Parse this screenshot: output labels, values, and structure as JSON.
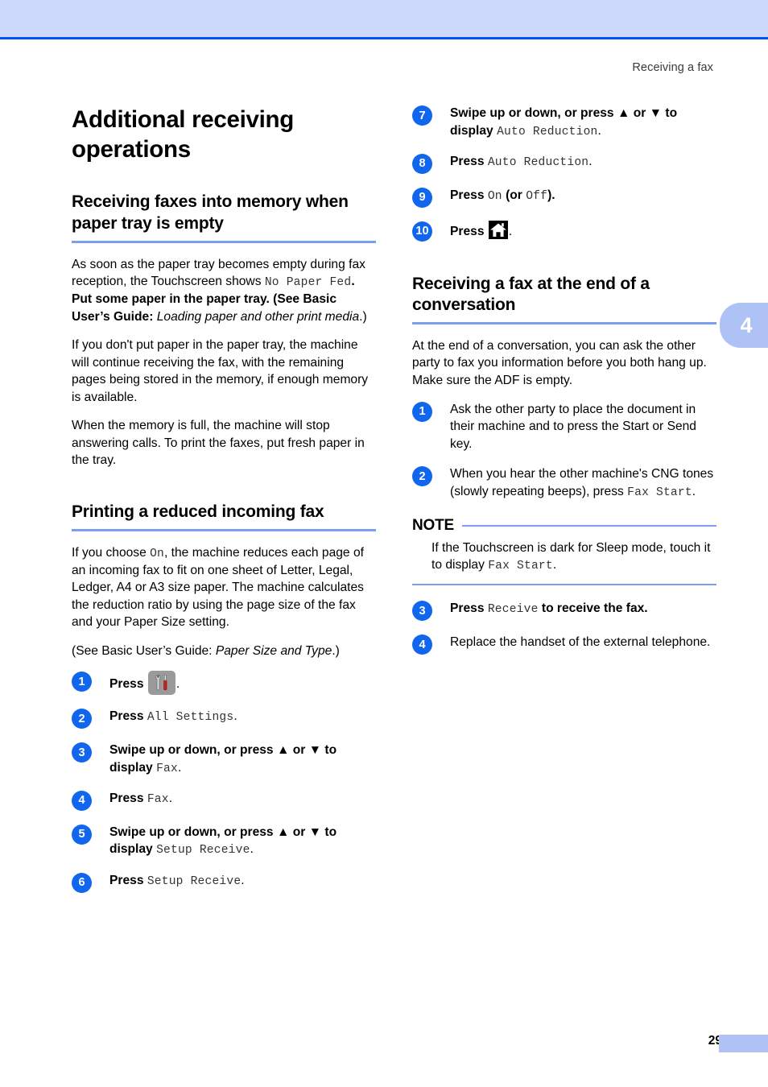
{
  "header": {
    "running_head": "Receiving a fax",
    "chapter_tab": "4"
  },
  "footer": {
    "page_number": "29"
  },
  "colors": {
    "band": "#ccd9fb",
    "band_rule": "#0055ee",
    "heading_rule": "#7b9ef0",
    "step_circle": "#1166ee",
    "chapter_tab": "#aec2f5"
  },
  "left_column": {
    "title": "Additional receiving operations",
    "section1": {
      "heading": "Receiving faxes into memory when paper tray is empty",
      "p1_a": "As soon as the paper tray becomes empty during fax reception, the Touchscreen shows ",
      "p1_mono": "No Paper Fed",
      "p1_b": ". Put some paper in the paper tray. (See Basic User’s Guide: ",
      "p1_ital": "Loading paper and other print media",
      "p1_c": ".)",
      "p2": "If you don't put paper in the paper tray, the machine will continue receiving the fax, with the remaining pages being stored in the memory, if enough memory is available.",
      "p3": "When the memory is full, the machine will stop answering calls. To print the faxes, put fresh paper in the tray."
    },
    "section2": {
      "heading": "Printing a reduced incoming fax",
      "p1_a": "If you choose ",
      "p1_mono": "On",
      "p1_b": ", the machine reduces each page of an incoming fax to fit on one sheet of Letter, Legal, Ledger, A4 or A3 size paper. The machine calculates the reduction ratio by using the page size of the fax and your Paper Size setting.",
      "p2_a": "(See Basic User’s Guide: ",
      "p2_ital": "Paper Size and Type",
      "p2_b": ".)",
      "steps": [
        {
          "num": "1",
          "lead": "Press ",
          "icon": "settings-icon",
          "trail": "."
        },
        {
          "num": "2",
          "lead": "Press ",
          "mono": "All Settings",
          "trail": "."
        },
        {
          "num": "3",
          "lead": "Swipe up or down, or press ▲ or ▼ to display ",
          "mono": "Fax",
          "trail": "."
        },
        {
          "num": "4",
          "lead": "Press ",
          "mono": "Fax",
          "trail": "."
        },
        {
          "num": "5",
          "lead": "Swipe up or down, or press ▲ or ▼ to display ",
          "mono": "Setup Receive",
          "trail": "."
        },
        {
          "num": "6",
          "lead": "Press ",
          "mono": "Setup Receive",
          "trail": "."
        }
      ]
    }
  },
  "right_column": {
    "steps_continued": [
      {
        "num": "7",
        "lead": "Swipe up or down, or press ▲ or ▼ to display ",
        "mono": "Auto Reduction",
        "trail": "."
      },
      {
        "num": "8",
        "lead": "Press ",
        "mono": "Auto Reduction",
        "trail": "."
      },
      {
        "num": "9",
        "lead": "Press ",
        "mono": "On",
        "mid": " (or ",
        "mono2": "Off",
        "trail": ")."
      },
      {
        "num": "10",
        "lead": "Press ",
        "icon": "home-icon",
        "trail": "."
      }
    ],
    "section3": {
      "heading": "Receiving a fax at the end of a conversation",
      "p1": "At the end of a conversation, you can ask the other party to fax you information before you both hang up. Make sure the ADF is empty.",
      "steps_a": [
        {
          "num": "1",
          "lead": "Ask the other party to place the document in their machine and to press the Start or Send key."
        },
        {
          "num": "2",
          "lead": "When you hear the other machine's CNG tones (slowly repeating beeps), press ",
          "mono": "Fax Start",
          "trail": "."
        }
      ],
      "note": {
        "label": "NOTE",
        "body_a": "If the Touchscreen is dark for Sleep mode, touch it to display ",
        "body_mono": "Fax Start",
        "body_b": "."
      },
      "steps_b": [
        {
          "num": "3",
          "lead": "Press ",
          "mono": "Receive",
          "trail": " to receive the fax."
        },
        {
          "num": "4",
          "lead": "Replace the handset of the external telephone."
        }
      ]
    }
  }
}
